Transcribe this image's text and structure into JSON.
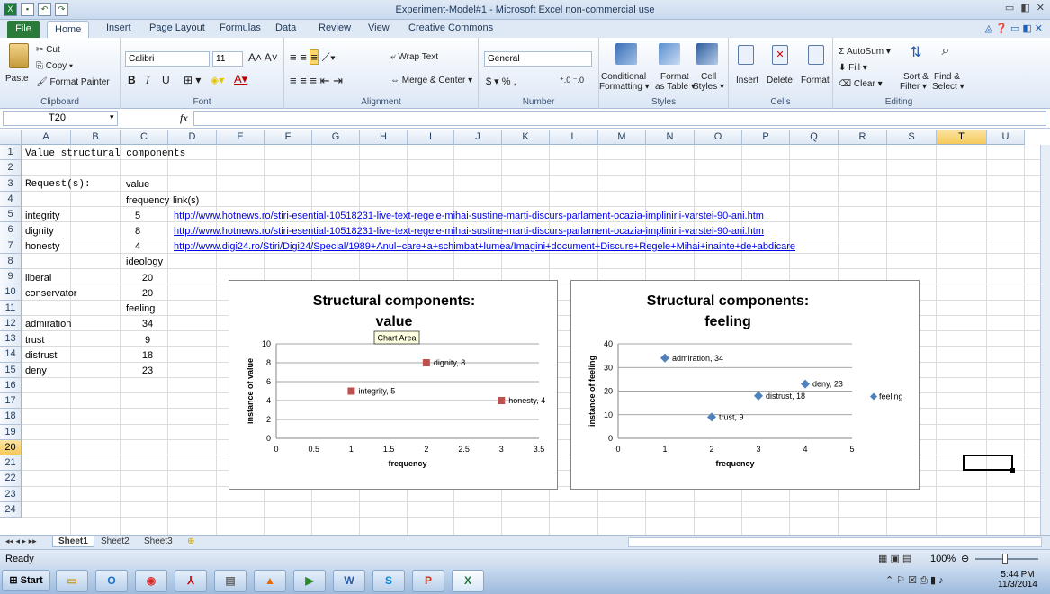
{
  "window": {
    "title": "Experiment-Model#1 - Microsoft Excel non-commercial use"
  },
  "tabs": [
    "File",
    "Home",
    "Insert",
    "Page Layout",
    "Formulas",
    "Data",
    "Review",
    "View",
    "Creative Commons"
  ],
  "ribbon": {
    "clipboard": {
      "paste": "Paste",
      "cut": "Cut",
      "copy": "Copy ▾",
      "format_painter": "Format Painter",
      "label": "Clipboard"
    },
    "font": {
      "name": "Calibri",
      "size": "11",
      "label": "Font",
      "bold": "B",
      "italic": "I",
      "underline": "U"
    },
    "alignment": {
      "wrap": "Wrap Text",
      "merge": "Merge & Center ▾",
      "label": "Alignment"
    },
    "number": {
      "format": "General",
      "currency": "$ ▾ % ,",
      "label": "Number"
    },
    "styles": {
      "conditional": "Conditional",
      "conditional2": "Formatting ▾",
      "format_table": "Format",
      "format_table2": "as Table ▾",
      "cell_styles": "Cell",
      "cell_styles2": "Styles ▾",
      "label": "Styles"
    },
    "cells": {
      "insert": "Insert",
      "delete": "Delete",
      "format": "Format",
      "label": "Cells"
    },
    "editing": {
      "autosum": "Σ AutoSum ▾",
      "fill": "Fill ▾",
      "clear": "Clear ▾",
      "sort": "Sort &",
      "sort2": "Filter ▾",
      "find": "Find &",
      "find2": "Select ▾",
      "label": "Editing"
    }
  },
  "formula_bar": {
    "name_box": "T20",
    "fx": "fx",
    "value": ""
  },
  "columns": [
    "A",
    "B",
    "C",
    "D",
    "E",
    "F",
    "G",
    "H",
    "I",
    "J",
    "K",
    "L",
    "M",
    "N",
    "O",
    "P",
    "Q",
    "R",
    "S",
    "T",
    "U"
  ],
  "rows": [
    "1",
    "2",
    "3",
    "4",
    "5",
    "6",
    "7",
    "8",
    "9",
    "10",
    "11",
    "12",
    "13",
    "14",
    "15",
    "16",
    "17",
    "18",
    "19",
    "20",
    "21",
    "22",
    "23",
    "24"
  ],
  "cells": {
    "a1": "Value structural components",
    "a3": "Request(s):",
    "c3": "value",
    "c4": "frequency",
    "d4": "link(s)",
    "a5": "integrity",
    "c5": "5",
    "d5": "http://www.hotnews.ro/stiri-esential-10518231-live-text-regele-mihai-sustine-marti-discurs-parlament-ocazia-implinirii-varstei-90-ani.htm",
    "a6": "dignity",
    "c6": "8",
    "d6": "http://www.hotnews.ro/stiri-esential-10518231-live-text-regele-mihai-sustine-marti-discurs-parlament-ocazia-implinirii-varstei-90-ani.htm",
    "a7": "honesty",
    "c7": "4",
    "d7": "http://www.digi24.ro/Stiri/Digi24/Special/1989+Anul+care+a+schimbat+lumea/Imagini+document+Discurs+Regele+Mihai+inainte+de+abdicare",
    "c8": "ideology",
    "a9": "liberal",
    "c9": "20",
    "a10": "conservator",
    "c10": "20",
    "c11": "feeling",
    "a12": "admiration",
    "c12": "34",
    "a13": "trust",
    "c13": "9",
    "a14": "distrust",
    "c14": "18",
    "a15": "deny",
    "c15": "23"
  },
  "chart_data": [
    {
      "type": "scatter",
      "title": "Structural components: value",
      "title_line1": "Structural components:",
      "title_line2": "value",
      "xlabel": "frequency",
      "ylabel": "instance of value",
      "xlim": [
        0,
        3.5
      ],
      "ylim": [
        0,
        10
      ],
      "xticks": [
        "0",
        "0.5",
        "1",
        "1.5",
        "2",
        "2.5",
        "3",
        "3.5"
      ],
      "yticks": [
        "0",
        "2",
        "4",
        "6",
        "8",
        "10"
      ],
      "color": "#c0504d",
      "grid": true,
      "tooltip": "Chart Area",
      "points": [
        {
          "x": 1,
          "y": 5,
          "label": "integrity, 5"
        },
        {
          "x": 2,
          "y": 8,
          "label": "dignity, 8"
        },
        {
          "x": 3,
          "y": 4,
          "label": "honesty, 4"
        }
      ]
    },
    {
      "type": "scatter",
      "title": "Structural components: feeling",
      "title_line1": "Structural components:",
      "title_line2": "feeling",
      "xlabel": "frequency",
      "ylabel": "instance of feeling",
      "xlim": [
        0,
        5
      ],
      "ylim": [
        0,
        40
      ],
      "xticks": [
        "0",
        "1",
        "2",
        "3",
        "4",
        "5"
      ],
      "yticks": [
        "0",
        "10",
        "20",
        "30",
        "40"
      ],
      "color": "#4f81bd",
      "grid": true,
      "legend": "feeling",
      "legend_position": "right",
      "points": [
        {
          "x": 1,
          "y": 34,
          "label": "admiration, 34"
        },
        {
          "x": 2,
          "y": 9,
          "label": "trust, 9"
        },
        {
          "x": 3,
          "y": 18,
          "label": "distrust, 18"
        },
        {
          "x": 4,
          "y": 23,
          "label": "deny, 23"
        }
      ]
    }
  ],
  "sheet_tabs": [
    "Sheet1",
    "Sheet2",
    "Sheet3"
  ],
  "status": {
    "ready": "Ready",
    "zoom": "100%"
  },
  "taskbar": {
    "start": "Start",
    "time": "5:44 PM",
    "date": "11/3/2014"
  }
}
